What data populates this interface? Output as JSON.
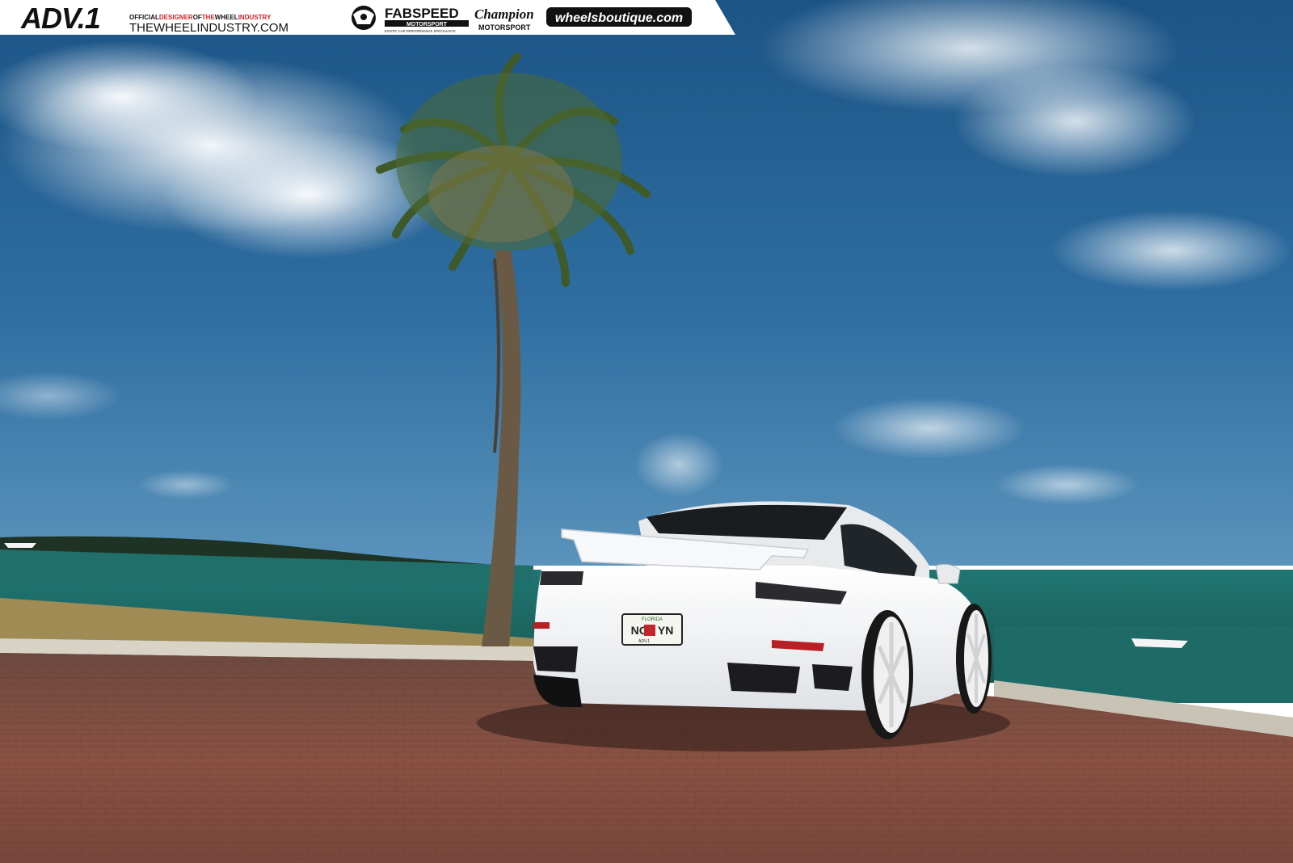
{
  "banner": {
    "adv1_logo": "ADV.1",
    "adv1_tagline_parts": [
      "OFFICIAL",
      "DESIGNER",
      "OF",
      "THE",
      "WHEEL",
      "INDUSTRY"
    ],
    "adv1_domain": "THEWHEELINDUSTRY.COM",
    "fabspeed_name": "FABSPEED",
    "fabspeed_sub": "MOTORSPORT",
    "fabspeed_tagline": "EXOTIC CAR PERFORMANCE SPECIALISTS",
    "champion_name": "Champion",
    "champion_sub": "MOTORSPORT",
    "wheelsboutique": "wheelsboutique.com",
    "colors": {
      "accent_red": "#d42027",
      "text_dark": "#111111",
      "banner_bg": "#ffffff"
    }
  },
  "vehicle": {
    "plate_state": "FLORIDA",
    "plate_number": "NOF   YN",
    "plate_frame": "ADV.1"
  },
  "colors": {
    "sky_top": "#1f5a8c",
    "sky_bottom": "#3d7fb0",
    "water": "#1e6b6a",
    "pavement": "#7e4a3e",
    "car_body": "#f2f3f4"
  }
}
